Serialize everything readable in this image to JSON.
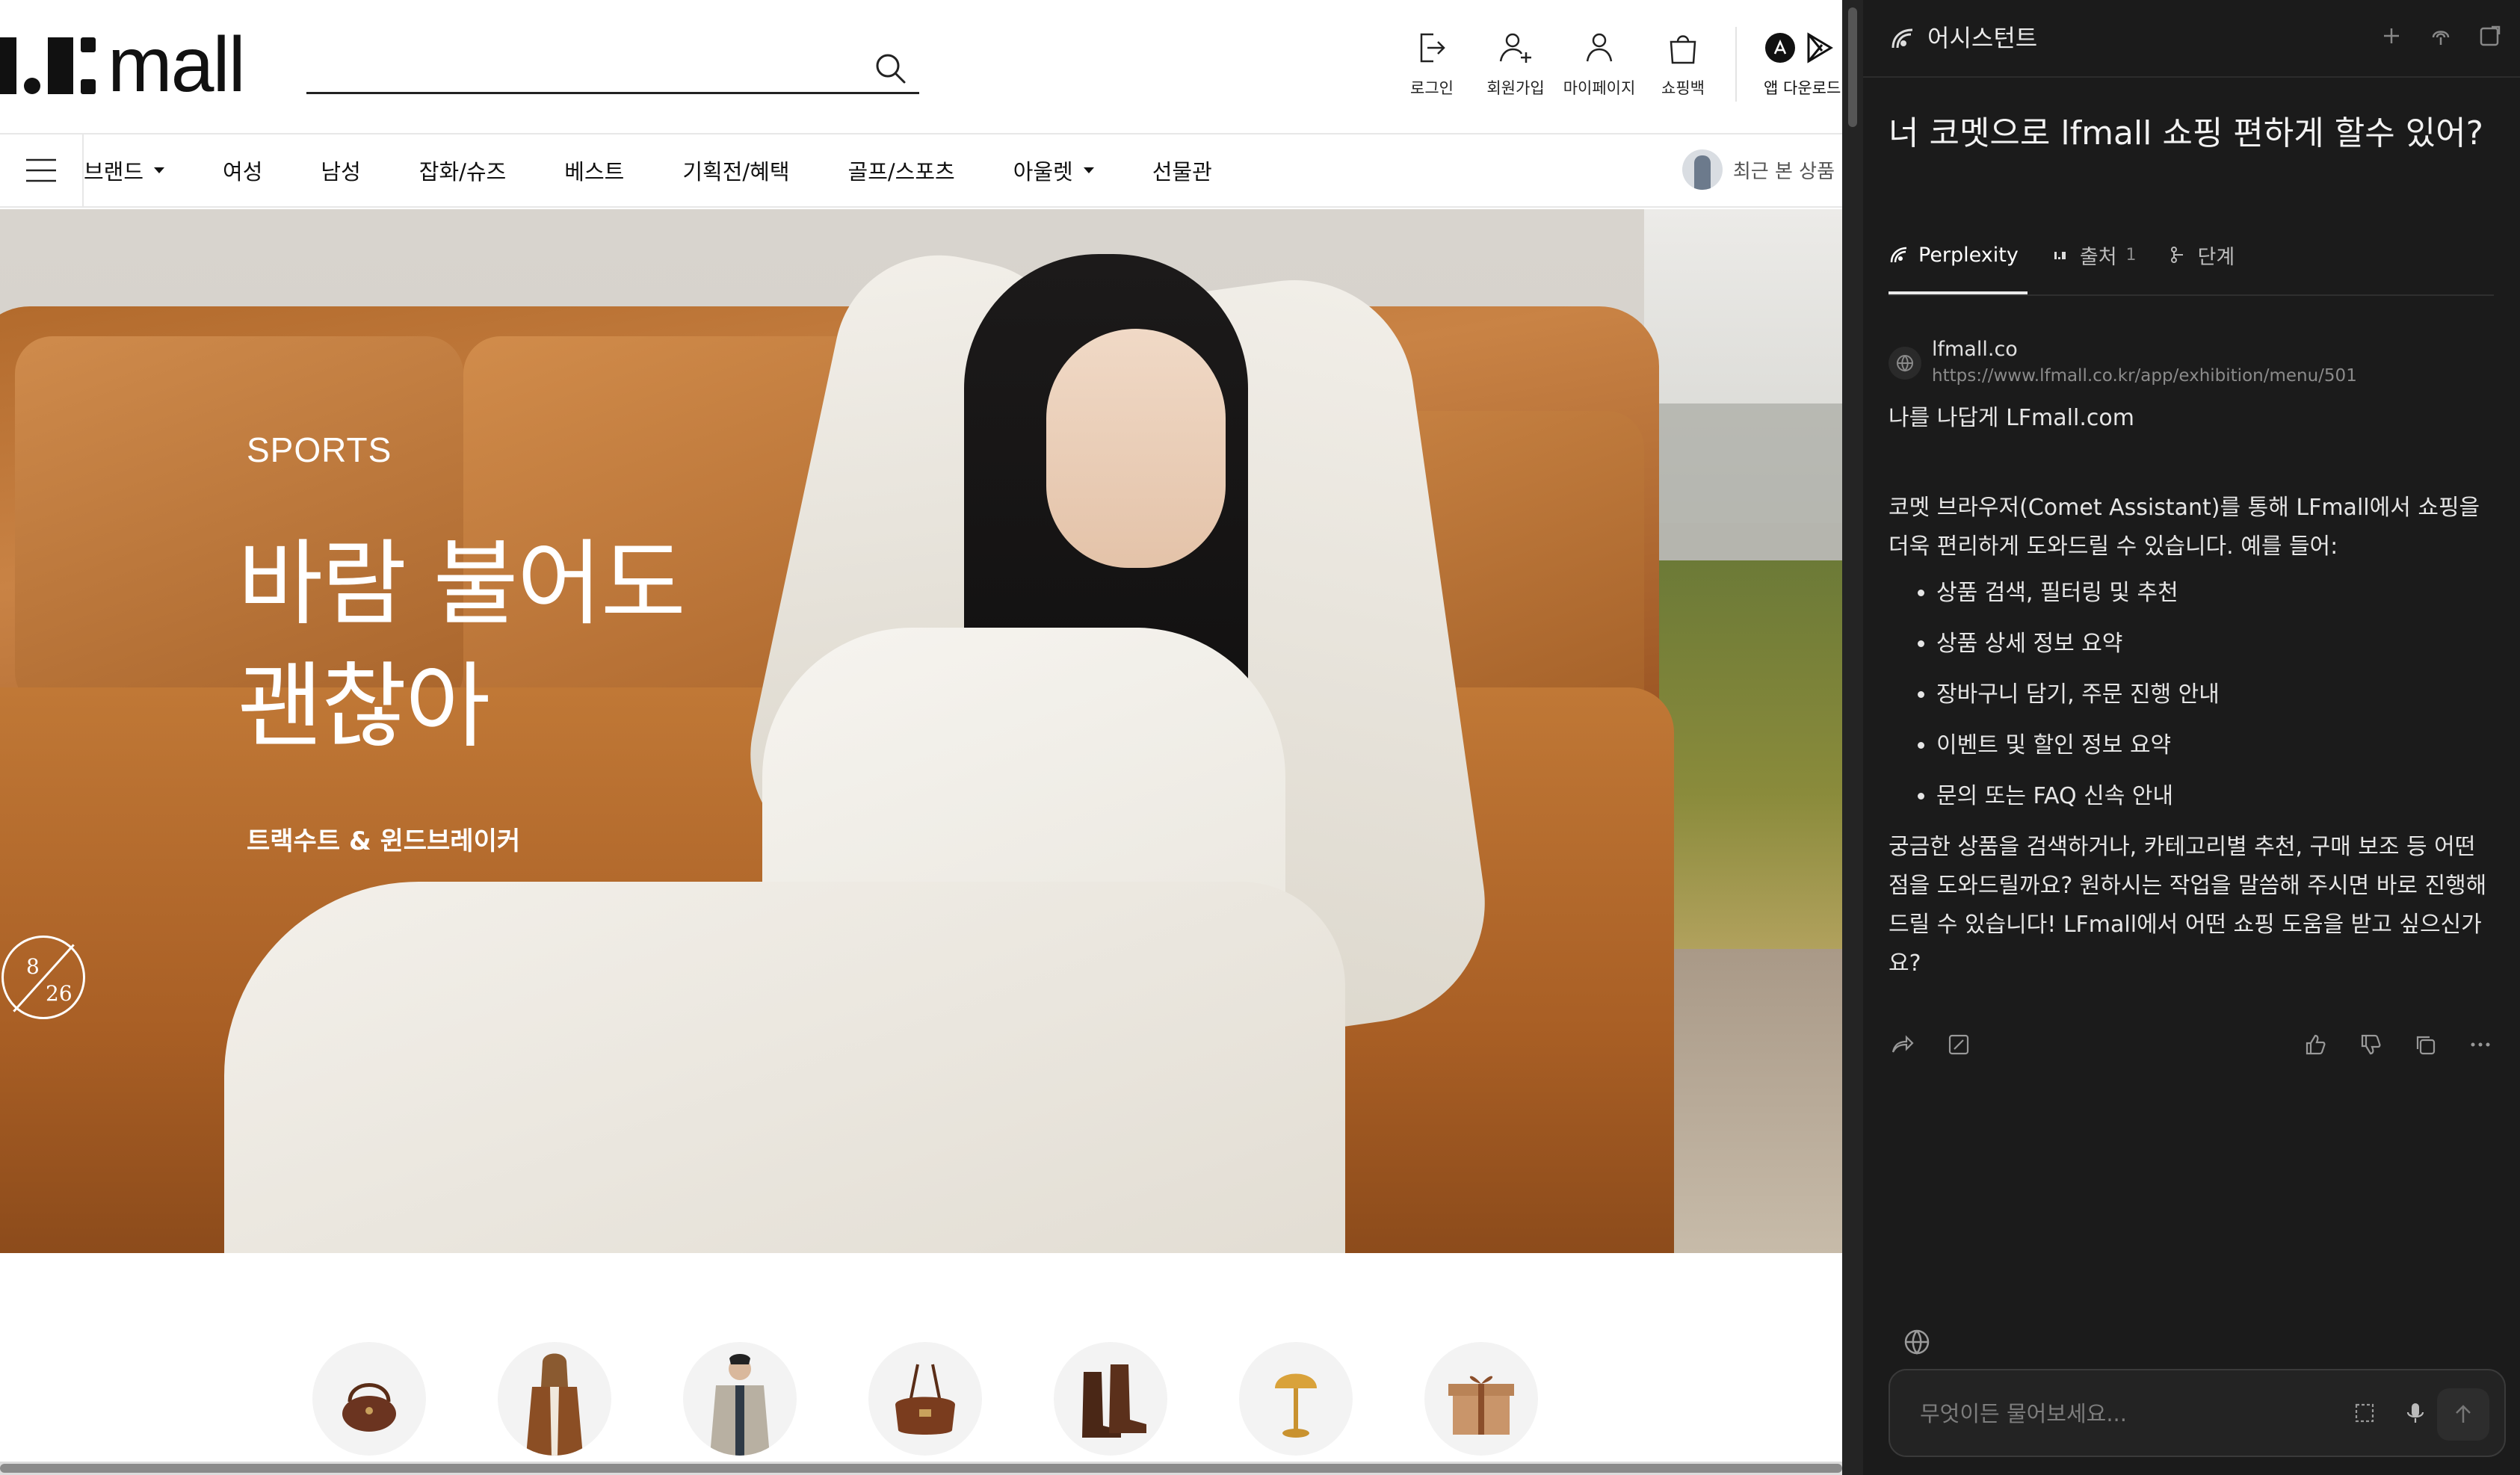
{
  "site": {
    "logo_text": "mall",
    "search": {
      "placeholder": "",
      "value": ""
    },
    "header_actions": [
      {
        "label": "로그인",
        "icon": "login-icon"
      },
      {
        "label": "회원가입",
        "icon": "add-user-icon"
      },
      {
        "label": "마이페이지",
        "icon": "user-icon"
      },
      {
        "label": "쇼핑백",
        "icon": "shopping-bag-icon"
      }
    ],
    "app_download_label": "앱 다운로드",
    "nav": [
      {
        "label": "브랜드",
        "dropdown": true
      },
      {
        "label": "여성",
        "dropdown": false
      },
      {
        "label": "남성",
        "dropdown": false
      },
      {
        "label": "잡화/슈즈",
        "dropdown": false
      },
      {
        "label": "베스트",
        "dropdown": false
      },
      {
        "label": "기획전/혜택",
        "dropdown": false
      },
      {
        "label": "골프/스포츠",
        "dropdown": false
      },
      {
        "label": "아울렛",
        "dropdown": true
      },
      {
        "label": "선물관",
        "dropdown": false
      }
    ],
    "recent_label": "최근 본 상품",
    "hero": {
      "eyebrow": "SPORTS",
      "headline": "바람 불어도\n괜찮아",
      "subtitle": "트랙수트 & 윈드브레이커",
      "slide_current": "8",
      "slide_total": "26"
    },
    "categories": [
      {
        "icon": "handbag-icon"
      },
      {
        "icon": "women-coat-icon"
      },
      {
        "icon": "men-jacket-icon"
      },
      {
        "icon": "shoulder-bag-icon"
      },
      {
        "icon": "boots-icon"
      },
      {
        "icon": "lamp-icon"
      },
      {
        "icon": "gift-box-icon"
      }
    ]
  },
  "assistant": {
    "title": "어시스턴트",
    "question": "너 코멧으로 lfmall 쇼핑 편하게 할수 있어?",
    "tabs": [
      {
        "label": "Perplexity",
        "active": true
      },
      {
        "label": "출처",
        "count": "1",
        "active": false
      },
      {
        "label": "단계",
        "active": false
      }
    ],
    "source": {
      "name": "lfmall.co",
      "url": "https://www.lfmall.co.kr/app/exhibition/menu/501",
      "title": "나를 나답게 LFmall.com"
    },
    "answer": {
      "intro": "코멧 브라우저(Comet Assistant)를 통해 LFmall에서 쇼핑을 더욱 편리하게 도와드릴 수 있습니다. 예를 들어:",
      "bullets": [
        "상품 검색, 필터링 및 추천",
        "상품 상세 정보 요약",
        "장바구니 담기, 주문 진행 안내",
        "이벤트 및 할인 정보 요약",
        "문의 또는 FAQ 신속 안내"
      ],
      "closing": "궁금한 상품을 검색하거나, 카테고리별 추천, 구매 보조 등 어떤 점을 도와드릴까요? 원하시는 작업을 말씀해 주시면 바로 진행해 드릴 수 있습니다! LFmall에서 어떤 쇼핑 도움을 받고 싶으신가요?"
    },
    "composer_placeholder": "무엇이든 물어보세요..."
  }
}
